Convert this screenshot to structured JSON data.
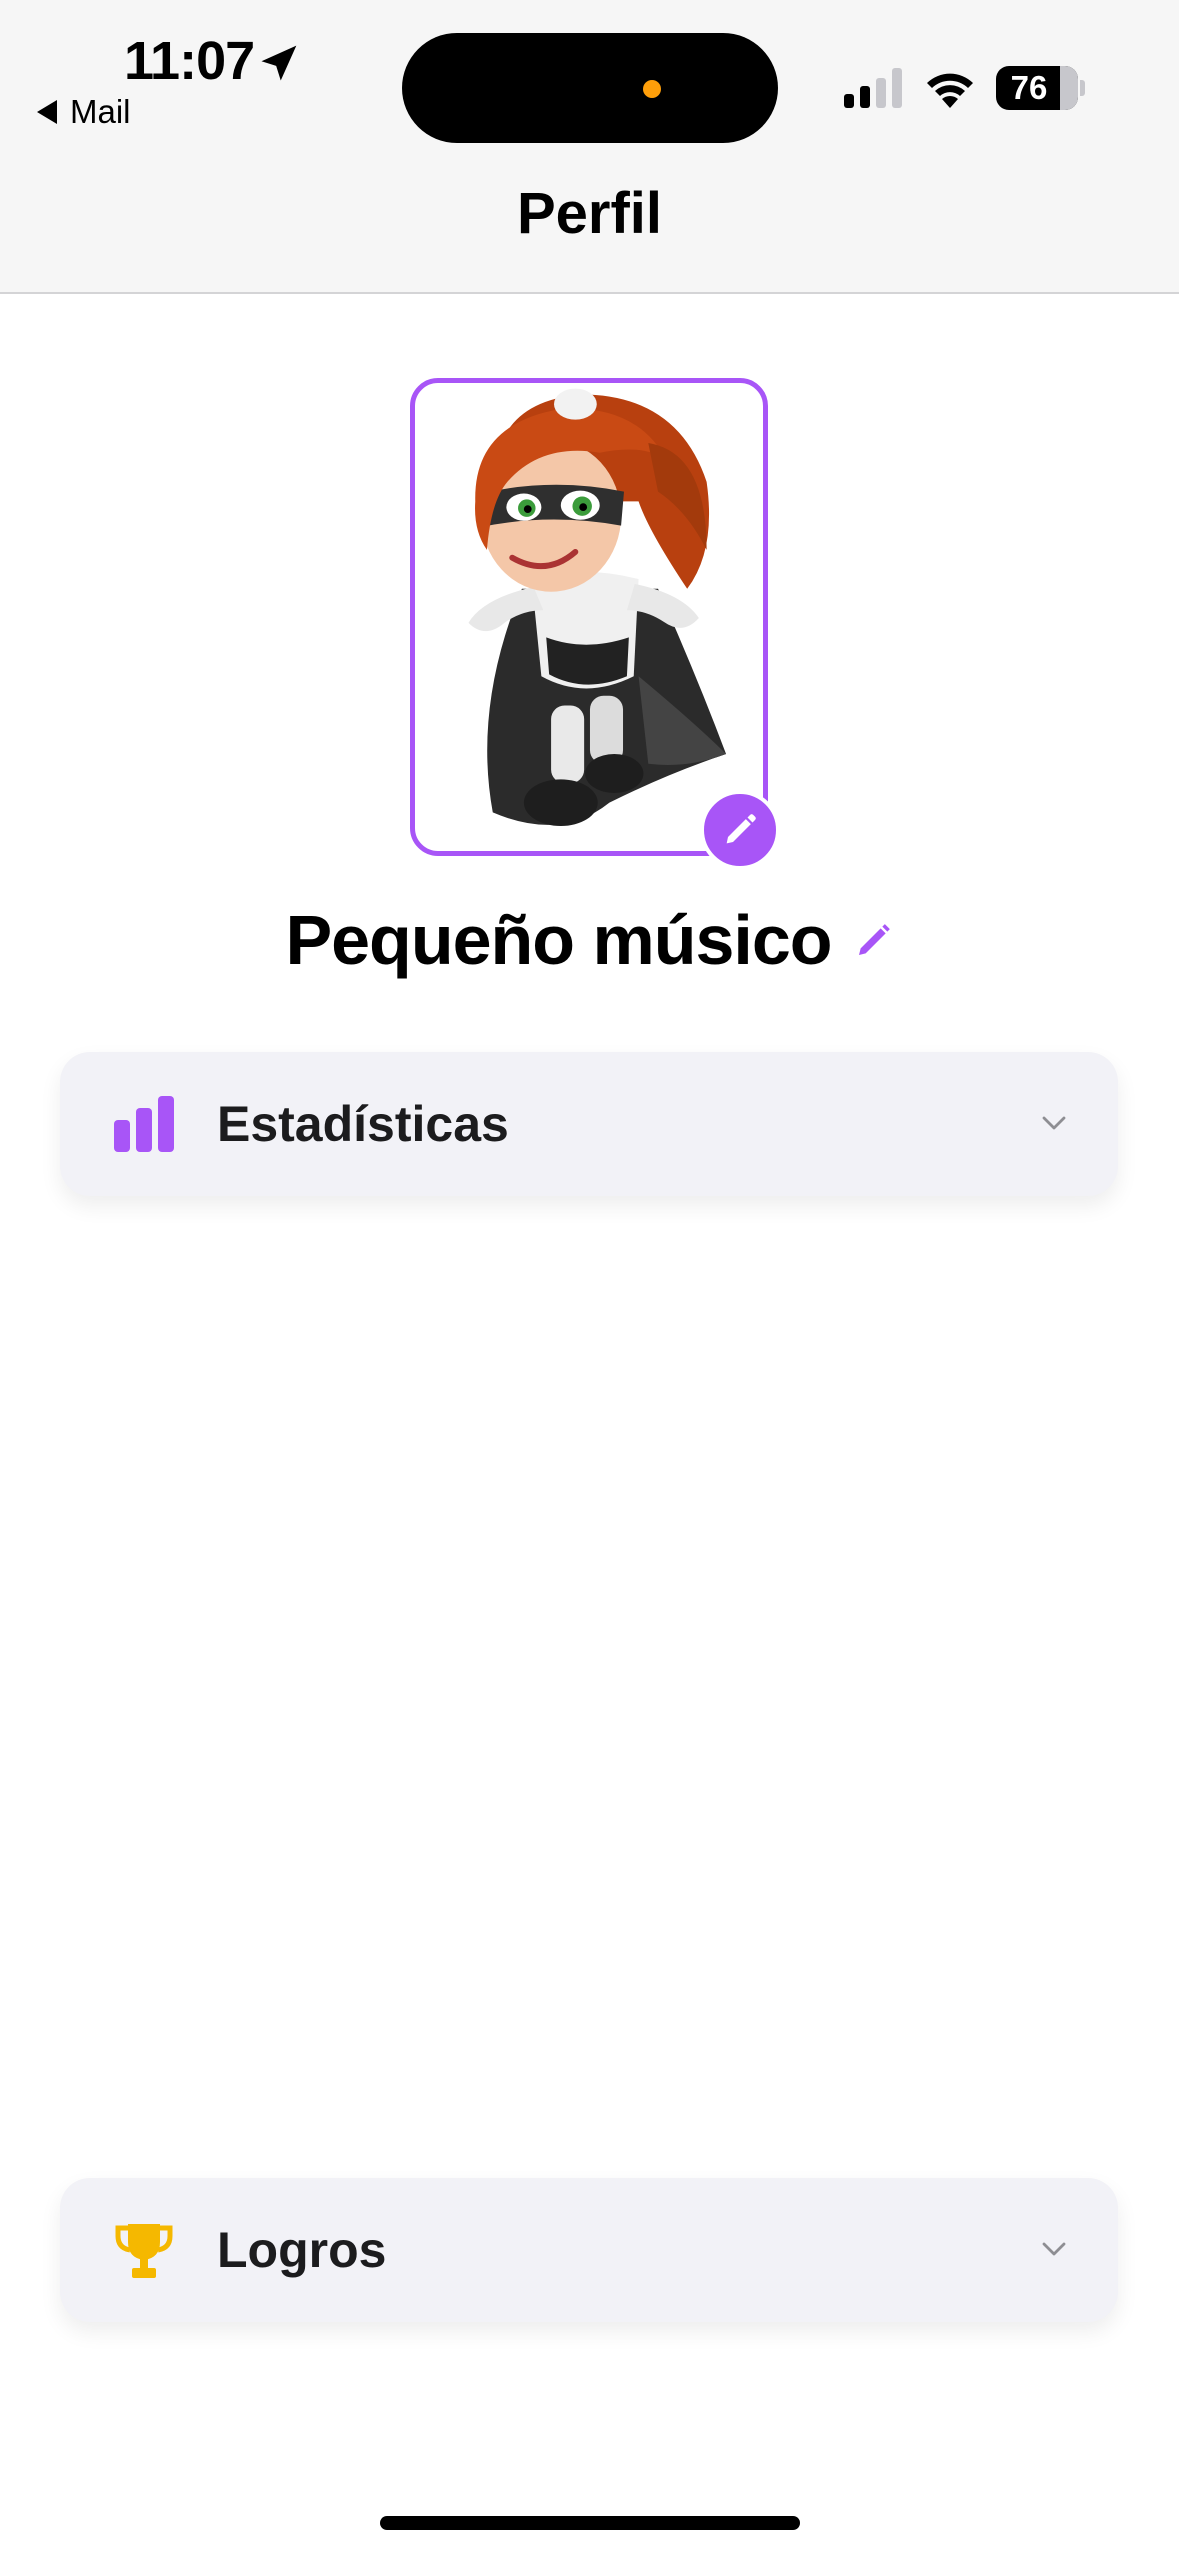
{
  "status_bar": {
    "time": "11:07",
    "back_app": "Mail",
    "battery": "76"
  },
  "header": {
    "title": "Perfil"
  },
  "profile": {
    "name": "Pequeño músico"
  },
  "sections": {
    "stats_label": "Estadísticas",
    "achievements_label": "Logros"
  },
  "colors": {
    "accent": "#a855f7",
    "trophy": "#f5b800",
    "card_bg": "#f2f2f7"
  },
  "icons": {
    "location": "location-arrow-icon",
    "back": "back-triangle-icon",
    "signal": "cellular-signal-icon",
    "wifi": "wifi-icon",
    "battery": "battery-icon",
    "avatar_edit": "pencil-icon",
    "name_edit": "pencil-icon",
    "stats": "bar-chart-icon",
    "achievements": "trophy-icon",
    "expand": "chevron-down-icon"
  }
}
